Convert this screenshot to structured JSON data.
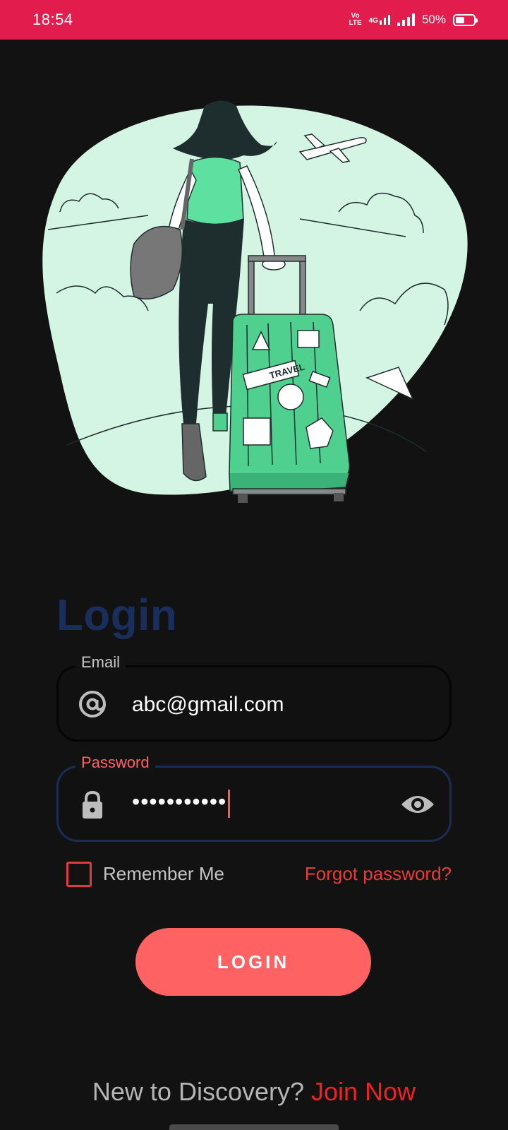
{
  "status_bar": {
    "time": "18:54",
    "volte_label": "Vo LTE",
    "network_label": "4G",
    "battery_percent": "50%",
    "battery_level": 0.5
  },
  "login": {
    "title": "Login",
    "email": {
      "label": "Email",
      "value": "abc@gmail.com"
    },
    "password": {
      "label": "Password",
      "masked_value": "•••••••••••"
    },
    "remember_label": "Remember Me",
    "remember_checked": false,
    "forgot_label": "Forgot password?",
    "button_label": "LOGIN"
  },
  "footer": {
    "prompt": "New to Discovery?",
    "join_label": "Join Now"
  },
  "colors": {
    "status_bar": "#e21c4c",
    "accent": "#ff6262",
    "title": "#1a2e5c",
    "link": "#ee2222",
    "illustration_bg": "#d4f5e4",
    "suitcase": "#4fd08f"
  },
  "icons": {
    "email": "at-sign-icon",
    "password": "lock-icon",
    "visibility": "eye-icon"
  }
}
